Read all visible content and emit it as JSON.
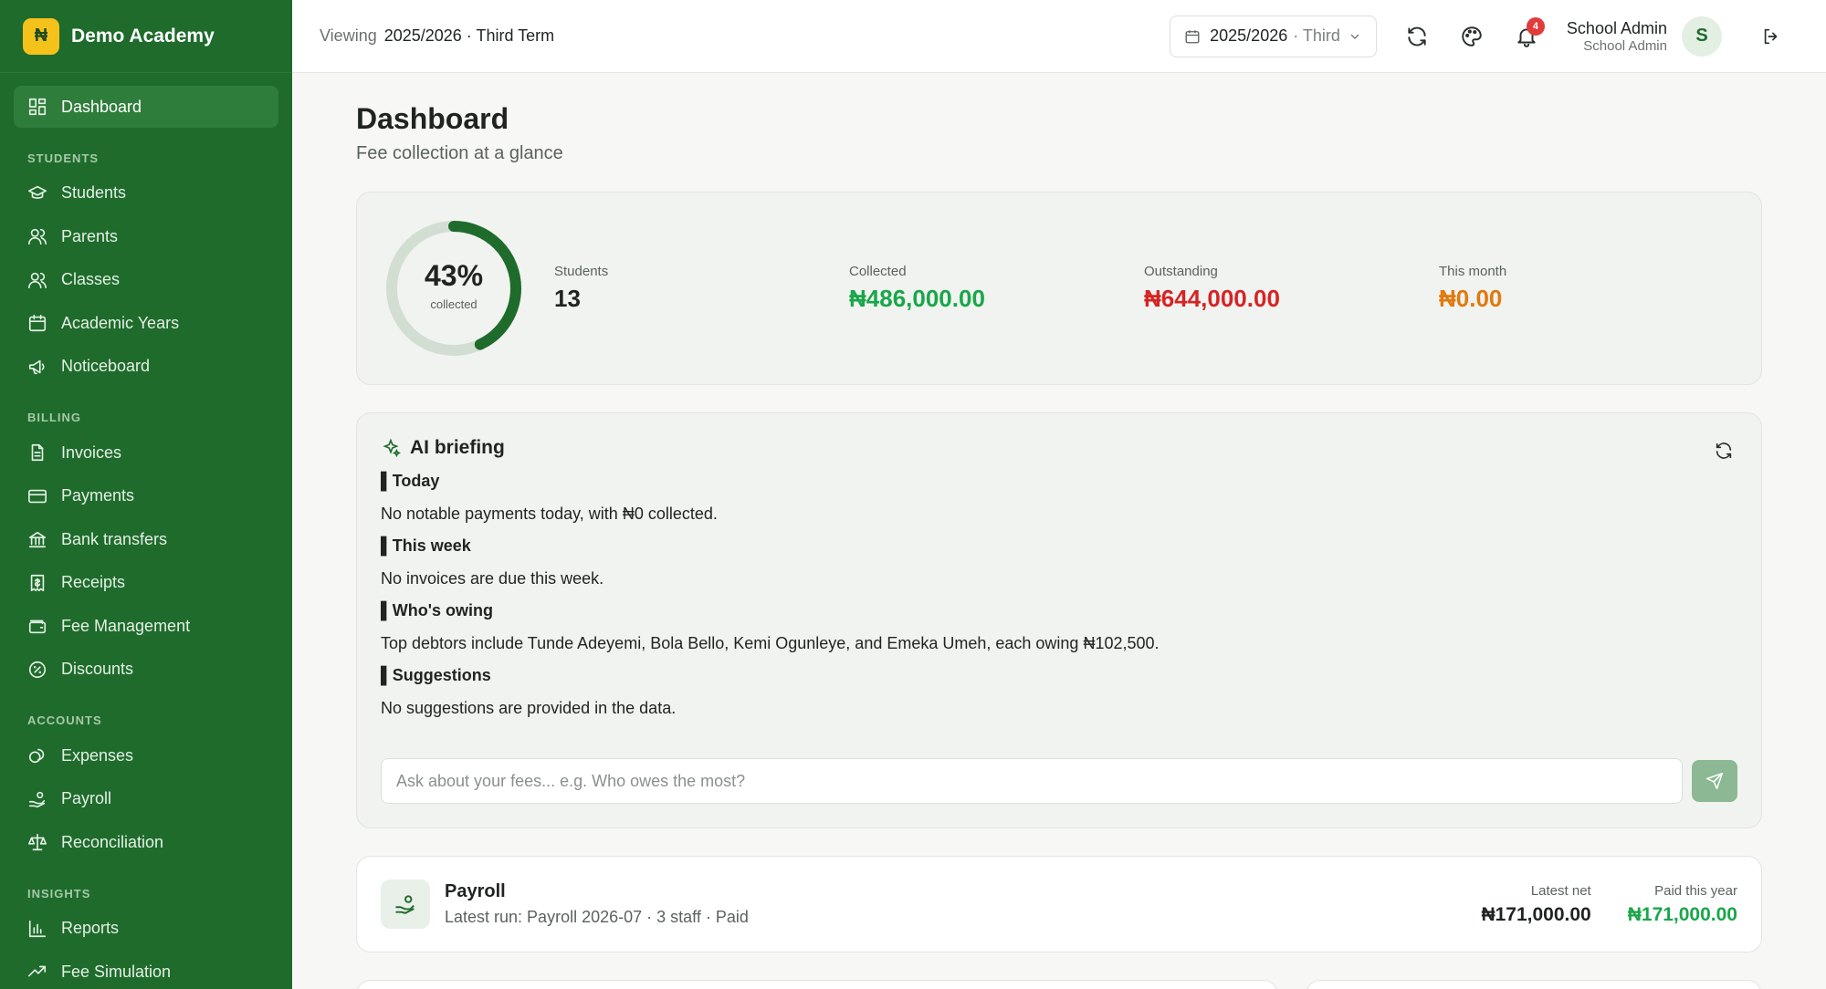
{
  "brand": {
    "logo_letter": "₦",
    "name": "Demo Academy",
    "logo_color": "#f4c21b",
    "sidebar_color": "#1f6b2c"
  },
  "sidebar": {
    "dashboard": "Dashboard",
    "sections": {
      "students": "STUDENTS",
      "billing": "BILLING",
      "accounts": "ACCOUNTS",
      "insights": "INSIGHTS"
    },
    "items": {
      "students": "Students",
      "parents": "Parents",
      "classes": "Classes",
      "academic_years": "Academic Years",
      "noticeboard": "Noticeboard",
      "invoices": "Invoices",
      "payments": "Payments",
      "bank_transfers": "Bank transfers",
      "receipts": "Receipts",
      "fee_management": "Fee Management",
      "discounts": "Discounts",
      "expenses": "Expenses",
      "payroll": "Payroll",
      "reconciliation": "Reconciliation",
      "reports": "Reports",
      "fee_simulation": "Fee Simulation"
    }
  },
  "topbar": {
    "viewing_label": "Viewing",
    "viewing_value": "2025/2026 · Third Term",
    "term_select": {
      "year": "2025/2026",
      "term": "· Third"
    },
    "notification_count": "4",
    "user_name": "School Admin",
    "user_role": "School Admin",
    "avatar_letter": "S"
  },
  "page": {
    "title": "Dashboard",
    "subtitle": "Fee collection at a glance"
  },
  "stats": {
    "collected_percent": "43%",
    "collected_fraction": 0.43,
    "ring_label": "collected",
    "students_label": "Students",
    "students_value": "13",
    "collected_label": "Collected",
    "collected_value": "₦486,000.00",
    "outstanding_label": "Outstanding",
    "outstanding_value": "₦644,000.00",
    "month_label": "This month",
    "month_value": "₦0.00"
  },
  "briefing": {
    "title": "AI briefing",
    "sections": [
      {
        "heading": "▌Today",
        "text": "No notable payments today, with ₦0 collected."
      },
      {
        "heading": "▌This week",
        "text": "No invoices are due this week."
      },
      {
        "heading": "▌Who's owing",
        "text": "Top debtors include Tunde Adeyemi, Bola Bello, Kemi Ogunleye, and Emeka Umeh, each owing ₦102,500."
      },
      {
        "heading": "▌Suggestions",
        "text": "No suggestions are provided in the data."
      }
    ],
    "ask_placeholder": "Ask about your fees... e.g. Who owes the most?"
  },
  "payroll": {
    "title": "Payroll",
    "subtitle": "Latest run: Payroll 2026-07 · 3 staff · Paid",
    "latest_net_label": "Latest net",
    "latest_net_value": "₦171,000.00",
    "paid_year_label": "Paid this year",
    "paid_year_value": "₦171,000.00"
  }
}
